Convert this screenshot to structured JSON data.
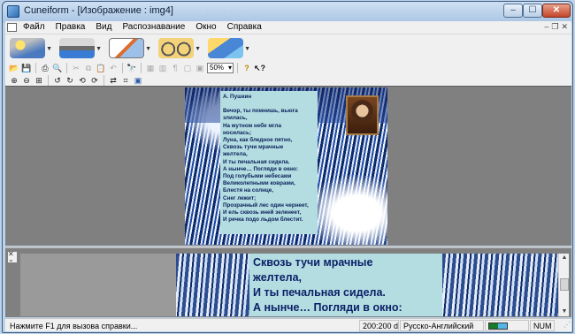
{
  "window": {
    "title": "Cuneiform - [Изображение : img4]",
    "buttons": {
      "minimize": "–",
      "maximize": "☐",
      "close": "✕"
    }
  },
  "menubar": {
    "items": [
      "Файл",
      "Правка",
      "Вид",
      "Распознавание",
      "Окно",
      "Справка"
    ],
    "mdi_buttons": {
      "minimize": "–",
      "restore": "❐",
      "close": "✕"
    }
  },
  "toolbar_big": [
    {
      "icon": "magic-wand-icon",
      "label": ""
    },
    {
      "icon": "scanner-icon",
      "label": ""
    },
    {
      "icon": "layout-icon",
      "label": ""
    },
    {
      "icon": "glasses-icon",
      "label": ""
    },
    {
      "icon": "send-icon",
      "label": ""
    }
  ],
  "toolbar_small": {
    "zoom_value": "50%"
  },
  "image": {
    "author": "А. Пушкин",
    "lines": [
      "Вечор, ты помнишь, вьюга",
      "злилась,",
      "На мутном небе мгла",
      "носилась;",
      "Луна, как бледное пятно,",
      "Сквозь тучи мрачные",
      "желтела,",
      "И ты печальная сидела.",
      "А нынче… Погляди в окно:",
      "Под голубыми небесами",
      "Великолепными коврами,",
      "Блестя на солнце,",
      "Снег лежит;",
      "Прозрачный лес один чернеет,",
      "И ель сквозь иней зеленеет,",
      "И речка подо льдом блестит."
    ]
  },
  "zoom_view": {
    "lines": [
      "Сквозь тучи мрачные",
      "желтела,",
      "И ты печальная сидела.",
      "А нынче… Погляди в окно:"
    ]
  },
  "statusbar": {
    "help": "Нажмите F1 для вызова справки...",
    "dpi": "200:200 dpi",
    "language": "Русско-Английский",
    "num": "NUM"
  },
  "colors": {
    "poem_background": "#b4dde1",
    "poem_text": "#0a1f66",
    "pane_background": "#808080"
  }
}
